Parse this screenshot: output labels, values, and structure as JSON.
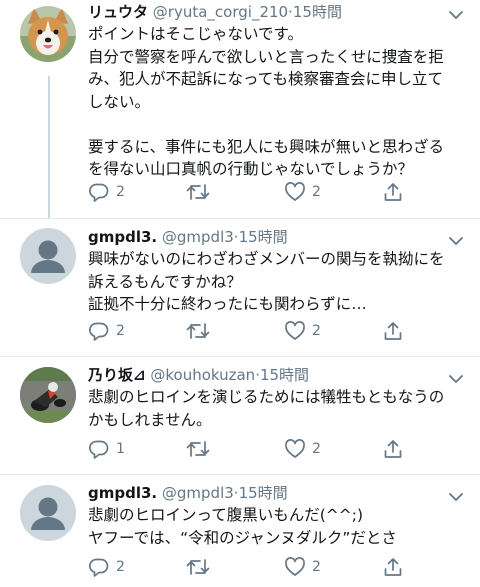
{
  "tweets": [
    {
      "name": "リュウタ",
      "handle": "@ryuta_corgi_210",
      "time": "15時間",
      "avatar_icon": "corgi-avatar",
      "body": "ポイントはそこじゃないです。\n自分で警察を呼んで欲しいと言ったくせに捜査を拒\nみ、犯人が不起訴になっても検察審査会に申し立て\nしない。\n\n要するに、事件にも犯人にも興味が無いと思わざる\nを得ない山口真帆の行動じゃないでしょうか？",
      "replies": "2",
      "retweets": "",
      "likes": "2"
    },
    {
      "name": "gmpdl3.",
      "handle": "@gmpdl3",
      "time": "15時間",
      "avatar_icon": "default-user-avatar",
      "body": "興味がないのにわざわざメンバーの関与を執拗にを\n訴えるもんですかね？\n証拠不十分に終わったにも関わらずに…",
      "replies": "2",
      "retweets": "",
      "likes": "2"
    },
    {
      "name": "乃り坂⊿",
      "handle": "@kouhokuzan",
      "time": "15時間",
      "avatar_icon": "motorcycle-racer-avatar",
      "body": "悲劇のヒロインを演じるためには犠牲もともなうの\nかもしれません。",
      "replies": "1",
      "retweets": "",
      "likes": "2"
    },
    {
      "name": "gmpdl3.",
      "handle": "@gmpdl3",
      "time": "15時間",
      "avatar_icon": "default-user-avatar",
      "body": "悲劇のヒロインって腹黒いもんだ(^^;)\nヤフーでは、“令和のジャンヌダルク”だとさ",
      "replies": "2",
      "retweets": "",
      "likes": "2"
    }
  ],
  "colors": {
    "text": "#14171a",
    "secondary": "#657786",
    "thread_line": "#ccd6dd",
    "divider": "#e6ecf0"
  },
  "icons": [
    "reply-icon",
    "retweet-icon",
    "like-icon",
    "share-icon",
    "caret-down-icon"
  ]
}
